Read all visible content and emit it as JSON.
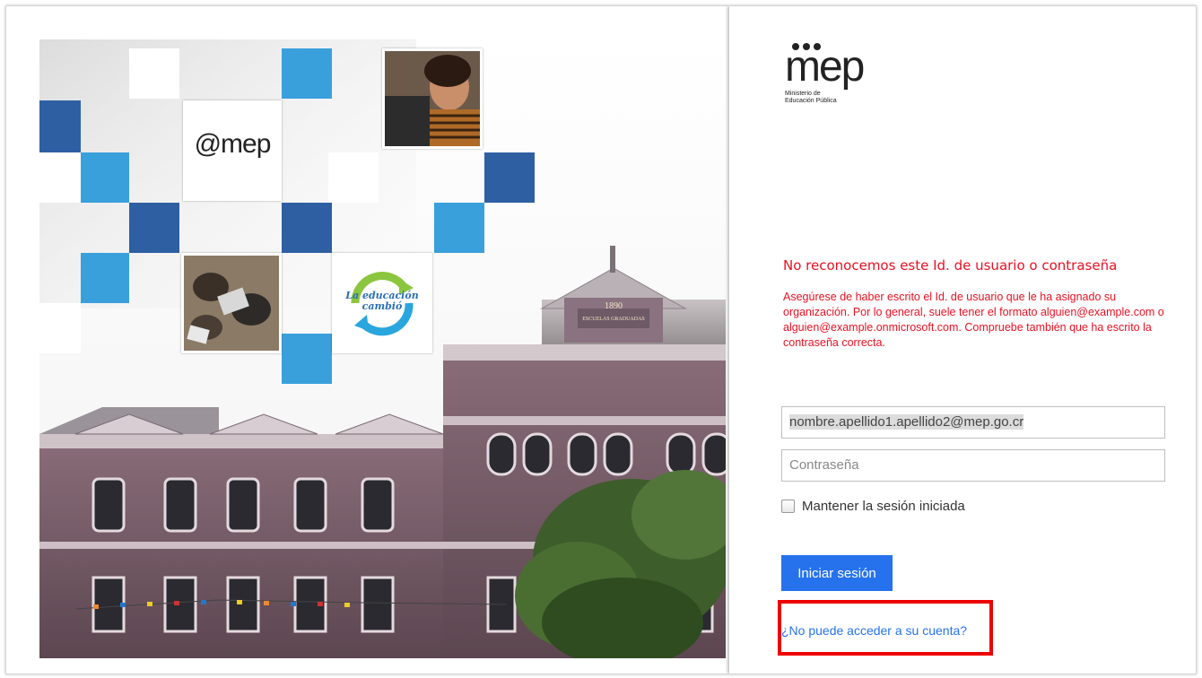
{
  "hero": {
    "brand_badge": "@mep",
    "campaign_logo": "La educación cambió",
    "building_sign_year": "1890",
    "building_sign_text": "ESCUELAS GRADUADAS"
  },
  "login": {
    "logo": {
      "word": "mep",
      "subtitle_line1": "Ministerio de",
      "subtitle_line2": "Educación Pública"
    },
    "error_title": "No reconocemos este Id. de usuario o contraseña",
    "error_message": "Asegúrese de haber escrito el Id. de usuario que le ha asignado su organización. Por lo general, suele tener el formato alguien@example.com o alguien@example.onmicrosoft.com. Compruebe también que ha escrito la contraseña correcta.",
    "user_value": "nombre.apellido1.apellido2@mep.go.cr",
    "password_placeholder": "Contraseña",
    "remember_label": "Mantener la sesión iniciada",
    "signin_label": "Iniciar sesión",
    "cant_access_link": "¿No puede acceder a su cuenta?"
  },
  "colors": {
    "error": "#e81123",
    "accent": "#2672ec",
    "highlight": "#ee0000",
    "tile_dark": "#2e5fa3",
    "tile_light": "#3aa0dc"
  }
}
